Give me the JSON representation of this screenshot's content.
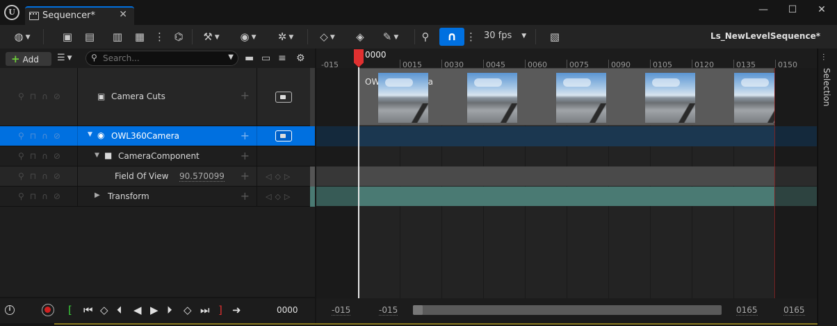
{
  "window": {
    "tab_title": "Sequencer*",
    "minimize_glyph": "—",
    "maximize_glyph": "☐",
    "close_glyph": "✕"
  },
  "toolbar": {
    "frame_rate": "30 fps",
    "sequence_name": "Ls_NewLevelSequence*",
    "icons": [
      "world-icon",
      "save-icon",
      "find-icon",
      "render-movie-icon",
      "clapper-icon",
      "more-icon",
      "curve-icon",
      "tools-icon",
      "view-icon",
      "playback-icon",
      "key-icon",
      "auto-key-icon",
      "edit-icon",
      "marker-icon",
      "snap-icon",
      "snap-options-icon",
      "frame-rate-icon",
      "curve-editor-icon"
    ],
    "accent_color": "#0070e0"
  },
  "filter_row": {
    "add_label": "Add",
    "search_placeholder": "Search..."
  },
  "tracks": [
    {
      "name": "Camera Cuts",
      "type": "camera-cuts"
    },
    {
      "name": "OWL360Camera",
      "type": "actor",
      "selected": true
    },
    {
      "name": "CameraComponent",
      "type": "component"
    },
    {
      "name": "Field Of View",
      "type": "property",
      "value": "90.570099"
    },
    {
      "name": "Transform",
      "type": "property"
    }
  ],
  "timeline": {
    "ticks": [
      "-015",
      "0015",
      "0030",
      "0045",
      "0060",
      "0075",
      "0090",
      "0105",
      "0120",
      "0135",
      "0150"
    ],
    "playhead": "0000",
    "cut_section_label": "OWL360Camera",
    "playhead_color": "#e03030"
  },
  "side_panel": {
    "label": "Selection"
  },
  "transport": {
    "current_time": "0000"
  },
  "bottom_range": {
    "view_start": "-015",
    "work_start": "-015",
    "work_end": "0165",
    "view_end": "0165"
  }
}
